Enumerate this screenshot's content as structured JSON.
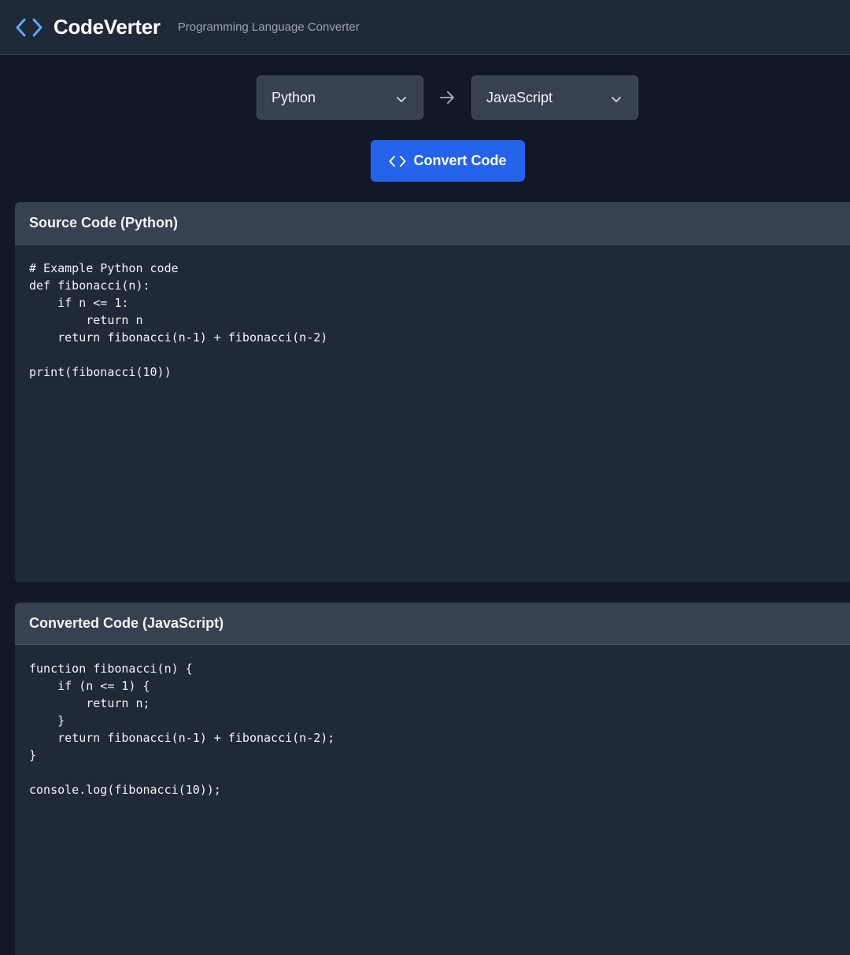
{
  "header": {
    "brand": "CodeVerter",
    "tagline": "Programming Language Converter",
    "icon": "code-brackets-icon",
    "accent": "#60a5fa"
  },
  "controls": {
    "source_language": "Python",
    "target_language": "JavaScript",
    "arrow_icon": "arrow-right-icon",
    "convert_label": "Convert Code",
    "convert_color": "#2563eb"
  },
  "source_panel": {
    "title": "Source Code (Python)",
    "lines": [
      "# Example Python code",
      "def fibonacci(n):",
      "    if n <= 1:",
      "        return n",
      "    return fibonacci(n-1) + fibonacci(n-2)",
      "",
      "print(fibonacci(10))"
    ]
  },
  "target_panel": {
    "title": "Converted Code (JavaScript)",
    "lines": [
      "function fibonacci(n) {",
      "    if (n <= 1) {",
      "        return n;",
      "    }",
      "    return fibonacci(n-1) + fibonacci(n-2);",
      "}",
      "",
      "console.log(fibonacci(10));"
    ]
  }
}
